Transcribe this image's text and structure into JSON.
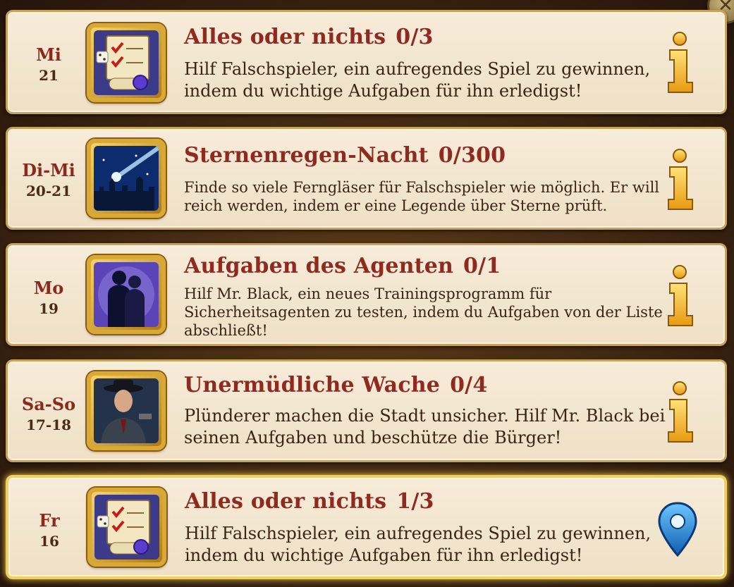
{
  "events": [
    {
      "day": "Mi",
      "num": "21",
      "title": "Alles oder nichts",
      "progress": "0/3",
      "description": "Hilf Falschspieler, ein aufregendes Spiel zu gewinnen, indem du wichtige Aufgaben für ihn erledigst!",
      "icon": "scroll-checklist-icon",
      "action_icon": "info-icon"
    },
    {
      "day": "Di-Mi",
      "num": "20-21",
      "title": "Sternenregen-Nacht",
      "progress": "0/300",
      "description": "Finde so viele Ferngläser für Falschspieler wie möglich. Er will reich werden, indem er eine Legende über Sterne prüft.",
      "icon": "shooting-star-icon",
      "action_icon": "info-icon"
    },
    {
      "day": "Mo",
      "num": "19",
      "title": "Aufgaben des Agenten",
      "progress": "0/1",
      "description": "Hilf Mr. Black, ein neues Trainingsprogramm für Sicherheitsagenten zu testen, indem du Aufgaben von der Liste abschließt!",
      "icon": "agents-silhouette-icon",
      "action_icon": "info-icon"
    },
    {
      "day": "Sa-So",
      "num": "17-18",
      "title": "Unermüdliche Wache",
      "progress": "0/4",
      "description": "Plünderer machen die Stadt unsicher. Hilf Mr. Black bei seinen Aufgaben und beschütze die Bürger!",
      "icon": "detective-portrait-icon",
      "action_icon": "info-icon"
    },
    {
      "day": "Fr",
      "num": "16",
      "title": "Alles oder nichts",
      "progress": "1/3",
      "description": "Hilf Falschspieler, ein aufregendes Spiel zu gewinnen, indem du wichtige Aufgaben für ihn erledigst!",
      "icon": "scroll-checklist-icon",
      "action_icon": "map-pin-icon"
    }
  ],
  "colors": {
    "title": "#8f2a20",
    "card_bg": "#f3e6cf",
    "frame_gold": "#d9a936",
    "active_glow": "#ffd75a",
    "pin_blue": "#1f8ad8"
  }
}
